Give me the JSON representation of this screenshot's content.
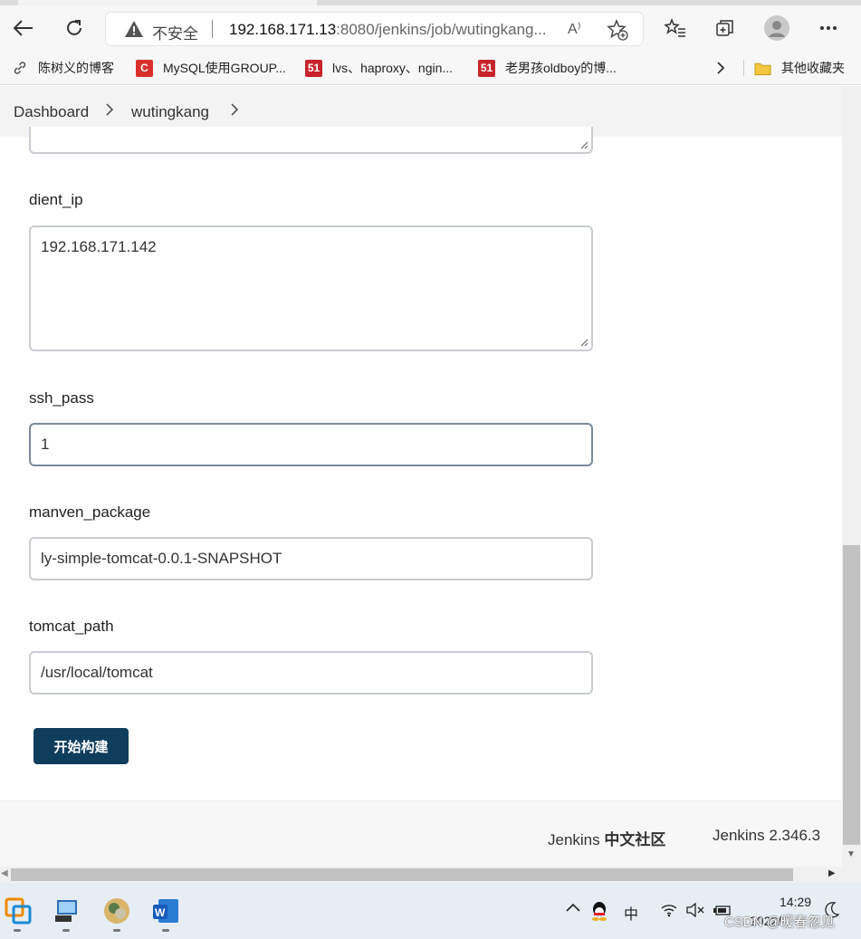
{
  "browser": {
    "back_icon": "back-arrow-icon",
    "refresh_icon": "refresh-icon",
    "security_label": "不安全",
    "url_host": "192.168.171.13",
    "url_rest": ":8080/jenkins/job/wutingkang...",
    "read_aloud": "A⁾"
  },
  "favorites": [
    {
      "label": "陈树义的博客",
      "icon": "link-icon"
    },
    {
      "label": "MySQL使用GROUP...",
      "icon": "c-icon",
      "badge": "C"
    },
    {
      "label": "lvs、haproxy、ngin...",
      "icon": "51-icon",
      "badge": "51"
    },
    {
      "label": "老男孩oldboy的博...",
      "icon": "51-icon",
      "badge": "51"
    }
  ],
  "favorites_other": "其他收藏夹",
  "breadcrumb": {
    "dashboard": "Dashboard",
    "job": "wutingkang"
  },
  "form": {
    "client_ip": {
      "label": "dient_ip",
      "value": "192.168.171.142"
    },
    "ssh_pass": {
      "label": "ssh_pass",
      "value": "1"
    },
    "manven_package": {
      "label": "manven_package",
      "value": "ly-simple-tomcat-0.0.1-SNAPSHOT"
    },
    "tomcat_path": {
      "label": "tomcat_path",
      "value": "/usr/local/tomcat"
    },
    "build_button": "开始构建"
  },
  "footer": {
    "community_prefix": "Jenkins ",
    "community_bold": "中文社区",
    "version": "Jenkins 2.346.3"
  },
  "taskbar": {
    "ime": "中",
    "time": "14:29",
    "date": "2022/",
    "watermark": "CSDN @暖春忽见"
  },
  "colors": {
    "build_button_bg": "#0f3d5c",
    "field_border": "#c8ccd2",
    "breadcrumb_bg": "#f3f3f3"
  }
}
